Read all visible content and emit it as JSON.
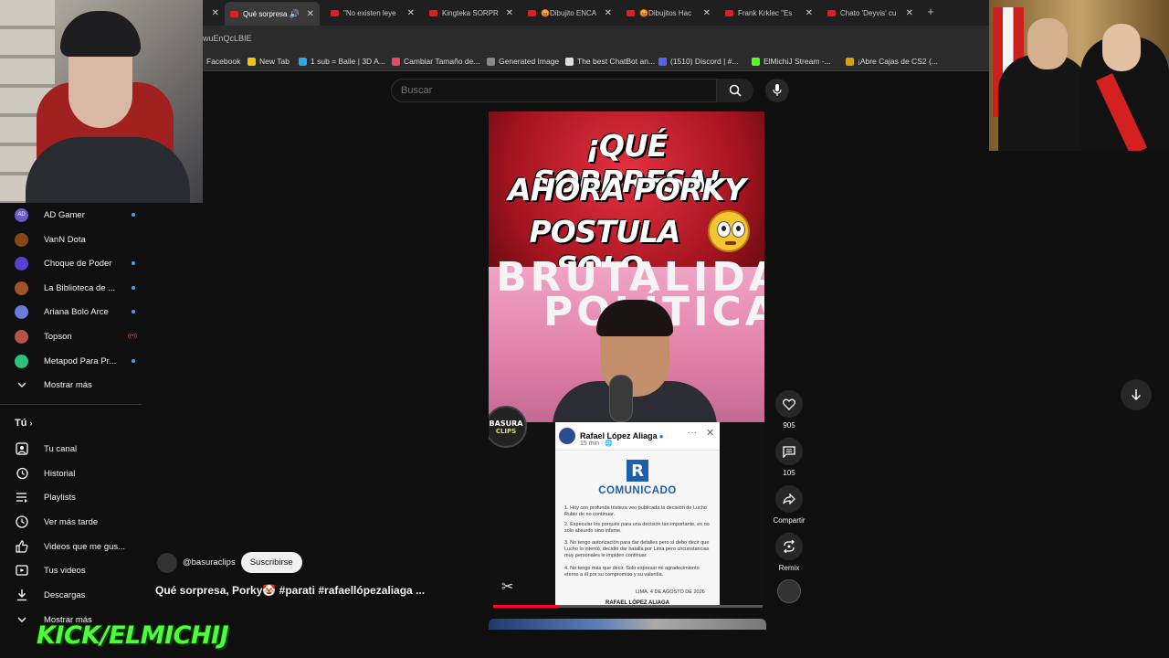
{
  "browser": {
    "tabs": [
      {
        "label": "Qué sorpresa",
        "active": true
      },
      {
        "label": "\"No existen leye"
      },
      {
        "label": "Kingteka SORPR"
      },
      {
        "label": "😡Dibujito ENCA"
      },
      {
        "label": "😡Dibujitos Hac"
      },
      {
        "label": "Frank Krklec \"Es"
      },
      {
        "label": "Chato 'Deyvis' cu"
      }
    ],
    "url": "wuEnQcLBIE",
    "bookmarks": [
      {
        "label": "Facebook",
        "color": "#1877f2"
      },
      {
        "label": "New Tab",
        "color": "#f1c40f"
      },
      {
        "label": "1 sub = Baile | 3D A...",
        "color": "#2ea7e0"
      },
      {
        "label": "Cambiar Tamaño de...",
        "color": "#e84a5f"
      },
      {
        "label": "Generated Image",
        "color": "#888888"
      },
      {
        "label": "The best ChatBot an...",
        "color": "#dddddd"
      },
      {
        "label": "(1510) Discord | #...",
        "color": "#5865f2"
      },
      {
        "label": "ElMichiJ Stream -...",
        "color": "#53fc18"
      },
      {
        "label": "¡Abre Cajas de CS2 (...",
        "color": "#d4a017"
      }
    ]
  },
  "search": {
    "placeholder": "Buscar"
  },
  "sidebar": {
    "subscriptions": [
      {
        "label": "AD Gamer",
        "badge": "dot",
        "color": "#6a5acd",
        "initials": "AD"
      },
      {
        "label": "VanN Dota",
        "badge": "",
        "color": "#8b4513",
        "initials": ""
      },
      {
        "label": "Choque de Poder",
        "badge": "dot",
        "color": "#5b3fd1",
        "initials": ""
      },
      {
        "label": "La Biblioteca de ...",
        "badge": "dot",
        "color": "#a0522d",
        "initials": ""
      },
      {
        "label": "Ariana Bolo Arce",
        "badge": "dot",
        "color": "#6b7bd6",
        "initials": ""
      },
      {
        "label": "Topson",
        "badge": "live",
        "color": "#b5524a",
        "initials": ""
      },
      {
        "label": "Metapod Para Pr...",
        "badge": "dot",
        "color": "#2ec27e",
        "initials": ""
      }
    ],
    "show_more": "Mostrar más",
    "you_title": "Tú",
    "you_items": [
      {
        "label": "Tu canal",
        "icon": "channel-icon"
      },
      {
        "label": "Historial",
        "icon": "history-icon"
      },
      {
        "label": "Playlists",
        "icon": "playlists-icon"
      },
      {
        "label": "Ver más tarde",
        "icon": "watch-later-icon"
      },
      {
        "label": "Videos que me gus...",
        "icon": "like-icon"
      },
      {
        "label": "Tus videos",
        "icon": "your-videos-icon"
      },
      {
        "label": "Descargas",
        "icon": "download-icon"
      }
    ],
    "show_more_2": "Mostrar más"
  },
  "short": {
    "headline": [
      "¡QUÉ SORPRESA!",
      "AHORA PORKY",
      "POSTULA SOLO."
    ],
    "bg_text": [
      "BRUTALIDAD",
      "POLÍTICA"
    ],
    "channel_logo_top": "BASURA",
    "channel_logo_bottom": "CLIPS",
    "fb_post": {
      "author": "Rafael López Aliaga",
      "time": "15 min · 🌐",
      "logo_letter": "R",
      "doc_title": "COMUNICADO",
      "points": [
        "1. Hoy con profunda tristeza veo publicada la decisión de Lucho Rubio de no continuar.",
        "2. Especular los porqués para una decisión tan importante, es no solo absurdo sino infame.",
        "3. No tengo autorización para dar detalles pero sí debo decir que Lucho lo intentó, decidió dar batalla por Lima pero circunstancias muy personales le impiden continuar.",
        "4. No tengo más que decir. Solo expresar mi agradecimiento eterno a él por su compromiso y su valentía."
      ],
      "date": "LIMA, 4 DE AGOSTO DE 2026",
      "signature": "RAFAEL LÓPEZ ALIAGA"
    },
    "progress": 0.24
  },
  "actions": {
    "likes": "905",
    "comments": "105",
    "share": "Compartir",
    "remix": "Remix"
  },
  "video": {
    "channel": "@basuraclips",
    "subscribe": "Suscribirse",
    "title": "Qué sorpresa, Porky🤡 #parati #rafaellópezaliaga ..."
  },
  "overlay": {
    "kick_text": "KICK/ELMICHIJ"
  }
}
